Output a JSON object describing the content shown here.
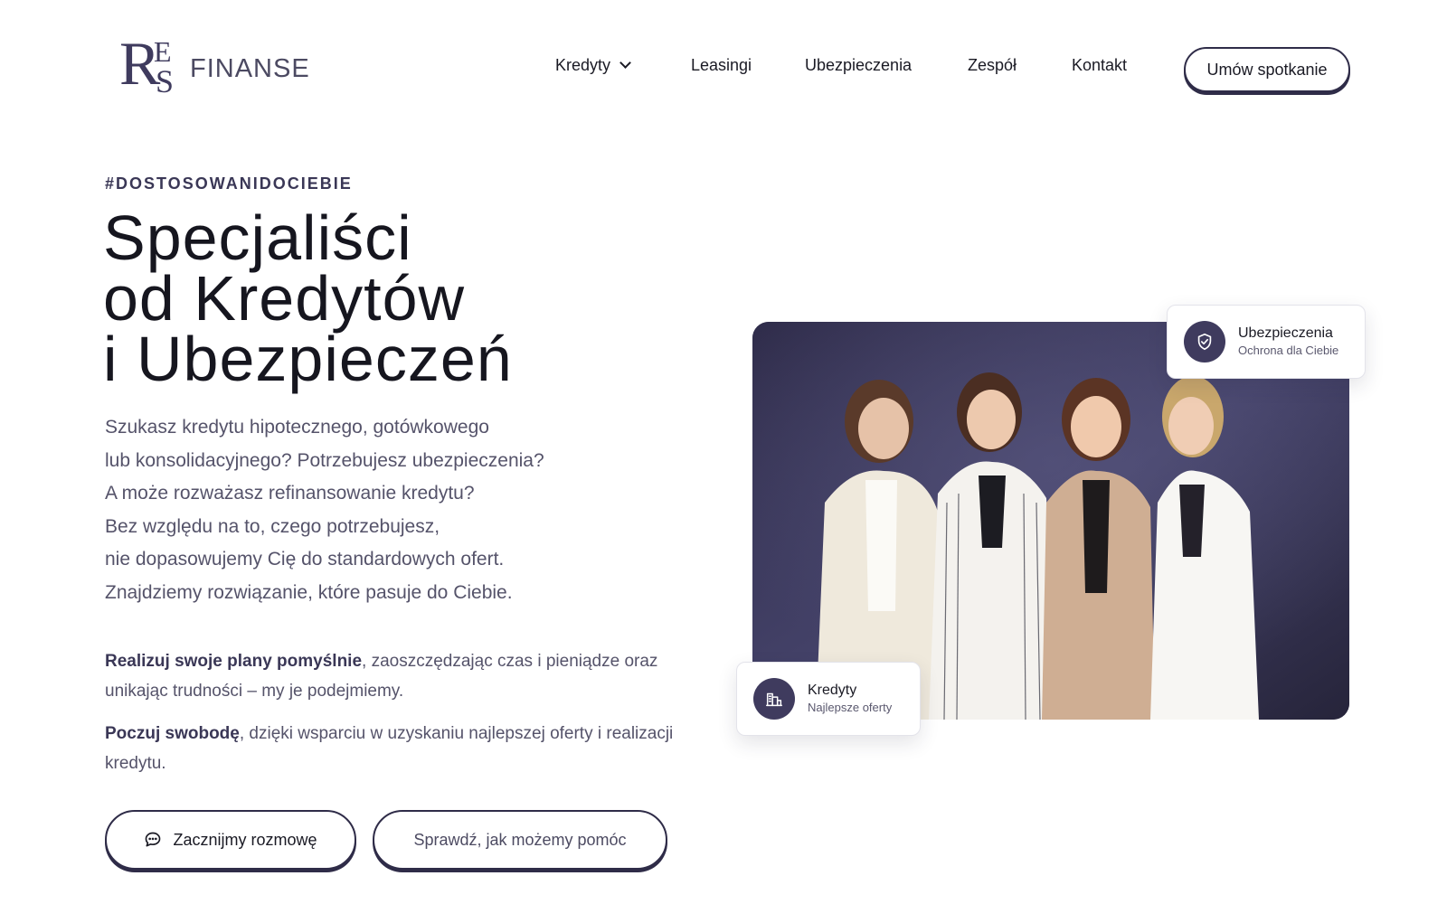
{
  "brand": {
    "logo_letters": [
      "R",
      "E",
      "S"
    ],
    "name": "FINANSE"
  },
  "nav": {
    "items": [
      {
        "label": "Kredyty",
        "has_dropdown": true
      },
      {
        "label": "Leasingi"
      },
      {
        "label": "Ubezpieczenia"
      },
      {
        "label": "Zespół"
      },
      {
        "label": "Kontakt"
      }
    ],
    "cta_label": "Umów spotkanie"
  },
  "hero": {
    "tag": "#DOSTOSOWANIDOCIEBIE",
    "title_lines": [
      "Specjaliści",
      "od Kredytów",
      "i Ubezpieczeń"
    ],
    "lead_lines": [
      "Szukasz kredytu hipotecznego, gotówkowego",
      "lub konsolidacyjnego? Potrzebujesz ubezpieczenia?",
      "A może rozważasz refinansowanie kredytu?",
      "Bez względu na to, czego potrzebujesz,",
      "nie dopasowujemy Cię do standardowych ofert.",
      "Znajdziemy rozwiązanie, które pasuje do Ciebie."
    ],
    "para1_bold": "Realizuj swoje plany pomyślnie",
    "para1_rest": ", zaoszczędzając czas i pieniądze oraz unikając trudności – my je podejmiemy.",
    "para2_bold": "Poczuj swobodę",
    "para2_rest": ", dzięki wsparciu w uzyskaniu najlepszej oferty i realizacji kredytu.",
    "primary_button": "Zacznijmy rozmowę",
    "secondary_button": "Sprawdź, jak możemy pomóc"
  },
  "badges": {
    "insurance": {
      "title": "Ubezpieczenia",
      "subtitle": "Ochrona dla Ciebie",
      "icon": "shield-check-icon"
    },
    "credit": {
      "title": "Kredyty",
      "subtitle": "Najlepsze oferty",
      "icon": "building-chart-icon"
    }
  },
  "colors": {
    "accent": "#3f3b5e",
    "text": "#1a1a24",
    "muted": "#55536a"
  }
}
